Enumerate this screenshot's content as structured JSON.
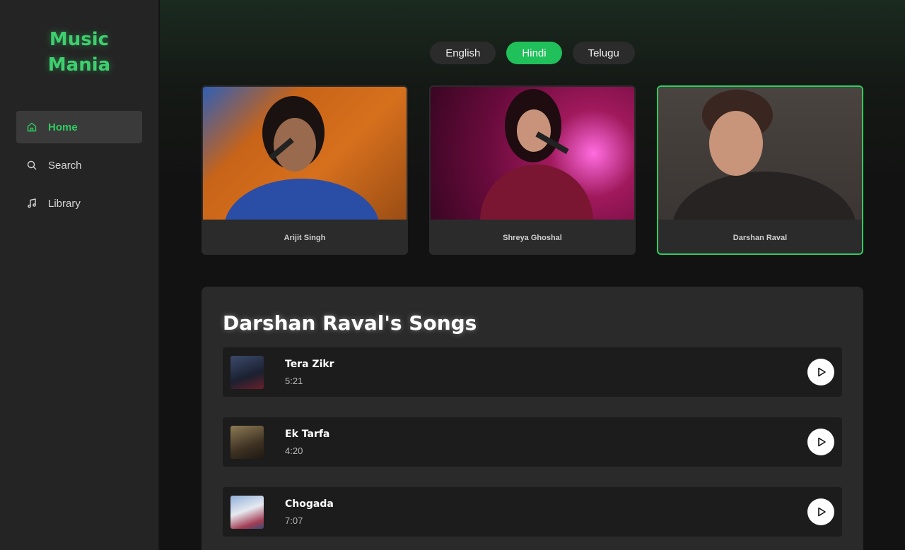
{
  "app": {
    "title": "Music Mania",
    "title_line1": "Music",
    "title_line2": "Mania"
  },
  "sidebar": {
    "items": [
      {
        "label": "Home",
        "icon": "home-icon",
        "active": true
      },
      {
        "label": "Search",
        "icon": "search-icon",
        "active": false
      },
      {
        "label": "Library",
        "icon": "music-note-icon",
        "active": false
      }
    ]
  },
  "languages": [
    {
      "label": "English",
      "active": false
    },
    {
      "label": "Hindi",
      "active": true
    },
    {
      "label": "Telugu",
      "active": false
    }
  ],
  "artists": [
    {
      "name": "Arijit Singh",
      "selected": false
    },
    {
      "name": "Shreya Ghoshal",
      "selected": false
    },
    {
      "name": "Darshan Raval",
      "selected": true
    }
  ],
  "songs_section": {
    "title": "Darshan Raval's Songs",
    "songs": [
      {
        "title": "Tera Zikr",
        "duration": "5:21"
      },
      {
        "title": "Ek Tarfa",
        "duration": "4:20"
      },
      {
        "title": "Chogada",
        "duration": "7:07"
      }
    ]
  },
  "colors": {
    "accent": "#2ecc5f",
    "brand": "#3ecf6e",
    "background": "#121212",
    "sidebar": "#242424"
  }
}
